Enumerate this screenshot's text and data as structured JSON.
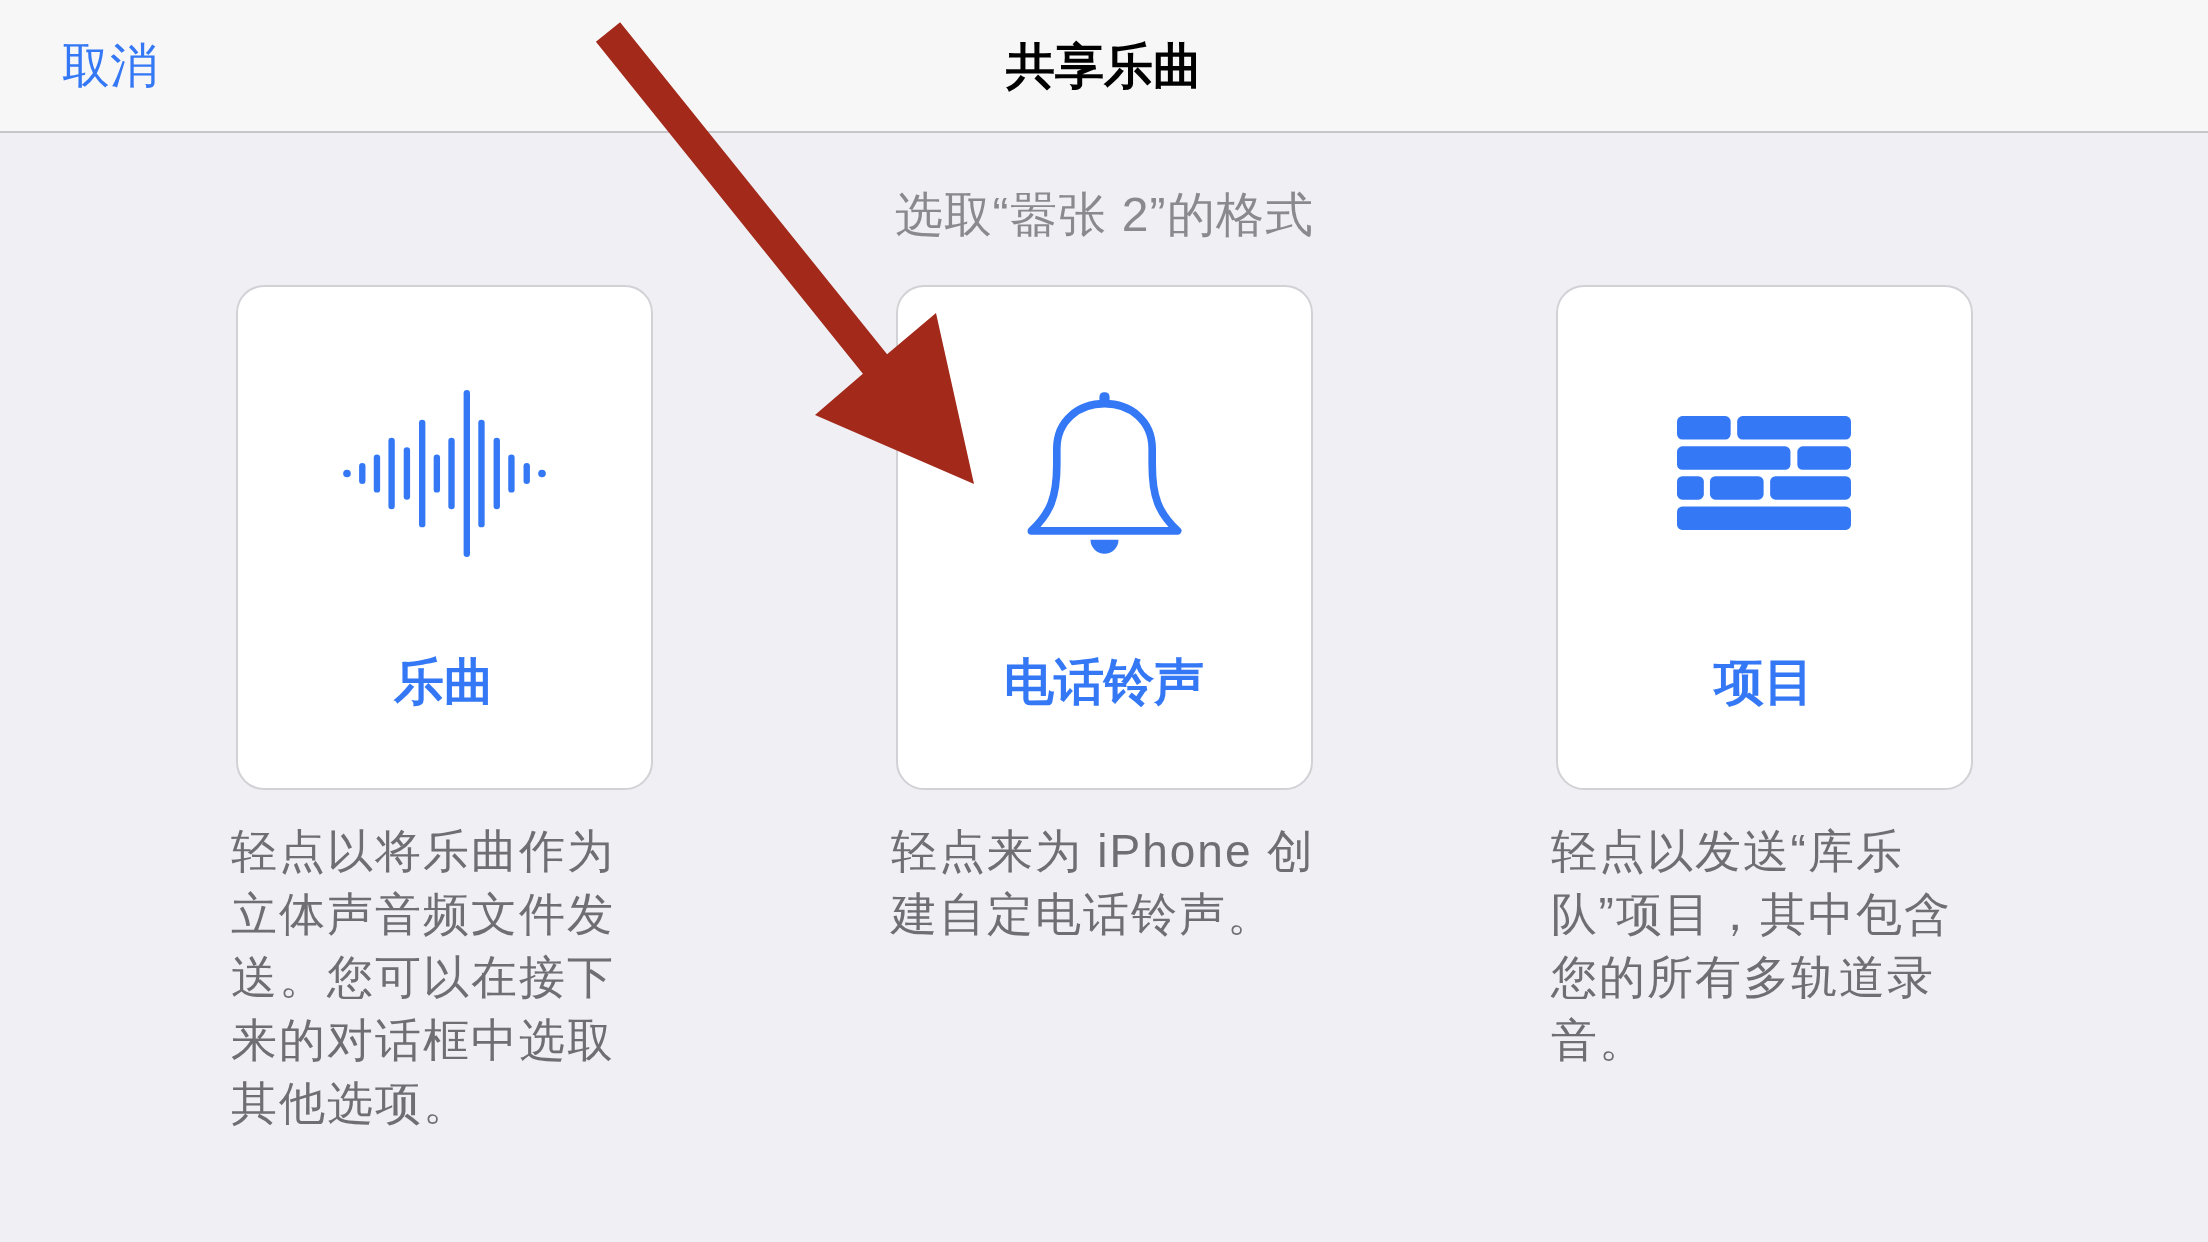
{
  "navigation_bar": {
    "cancel_button": "取消",
    "title": "共享乐曲"
  },
  "prompt": "选取“嚣张 2”的格式",
  "formats": [
    {
      "kind": "waveform",
      "label": "乐曲",
      "description": "轻点以将乐曲作为立体声音频文件发送。您可以在接下来的对话框中选取其他选项。"
    },
    {
      "kind": "bell",
      "label": "电话铃声",
      "description": "轻点来为 iPhone 创建自定电话铃声。"
    },
    {
      "kind": "bricks",
      "label": "项目",
      "description": "轻点以发送“库乐队”项目，其中包含您的所有多轨道录音。"
    }
  ],
  "annotations": [
    {
      "kind": "arrow"
    }
  ]
}
